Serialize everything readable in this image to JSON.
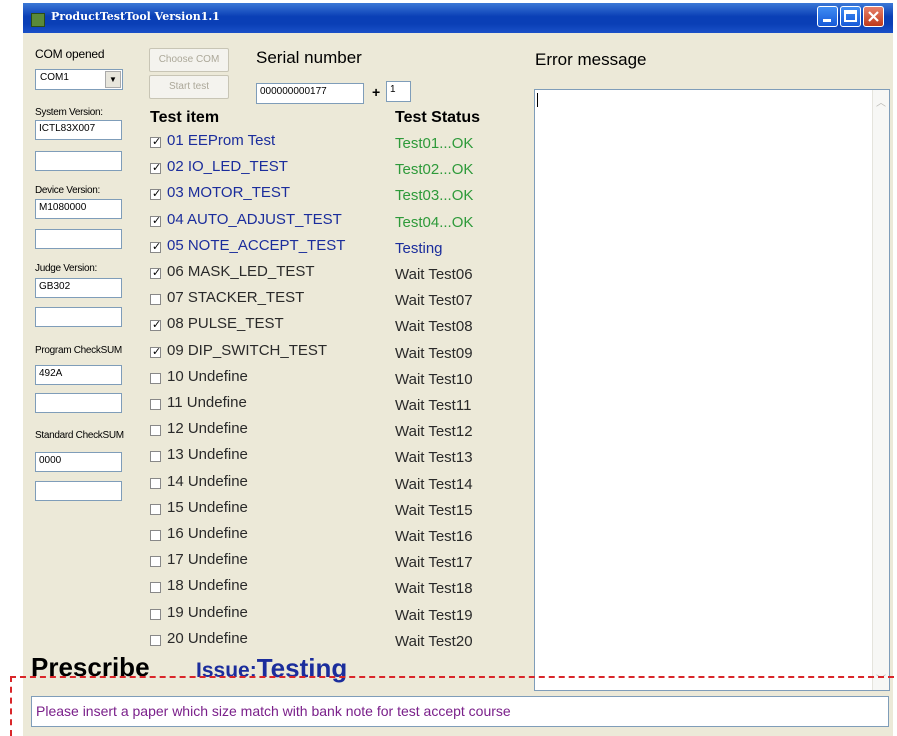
{
  "window": {
    "title": "ProductTestTool  Version1.1"
  },
  "left": {
    "com_label": "COM opened",
    "com_select": "COM1",
    "system_version_label": "System Version:",
    "system_version_value": "ICTL83X007",
    "system_version_value2": "",
    "device_version_label": "Device Version:",
    "device_version_value": "M1080000",
    "device_version_value2": "",
    "judge_version_label": "Judge Version:",
    "judge_version_value": "GB302",
    "judge_version_value2": "",
    "program_checksum_label": "Program CheckSUM",
    "program_checksum_value": "492A",
    "program_checksum_value2": "",
    "standard_checksum_label": "Standard CheckSUM",
    "standard_checksum_value": "0000",
    "standard_checksum_value2": ""
  },
  "buttons": {
    "choose_com": "Choose COM",
    "start_test": "Start test"
  },
  "serial": {
    "label": "Serial number",
    "value": "000000000177",
    "plus": "+",
    "increment": "1"
  },
  "headers": {
    "test_item": "Test item",
    "test_status": "Test Status",
    "error_message": "Error message"
  },
  "tests": [
    {
      "label": "01 EEProm Test",
      "checked": true,
      "status": "Test01...OK",
      "status_color": "#2e9a3a",
      "label_color": "#1b2d9c"
    },
    {
      "label": "02 IO_LED_TEST",
      "checked": true,
      "status": "Test02...OK",
      "status_color": "#2e9a3a",
      "label_color": "#1b2d9c"
    },
    {
      "label": "03 MOTOR_TEST",
      "checked": true,
      "status": "Test03...OK",
      "status_color": "#2e9a3a",
      "label_color": "#1b2d9c"
    },
    {
      "label": "04 AUTO_ADJUST_TEST",
      "checked": true,
      "status": "Test04...OK",
      "status_color": "#2e9a3a",
      "label_color": "#1b2d9c"
    },
    {
      "label": "05 NOTE_ACCEPT_TEST",
      "checked": true,
      "status": "Testing",
      "status_color": "#1b2d9c",
      "label_color": "#1b2d9c"
    },
    {
      "label": "06 MASK_LED_TEST",
      "checked": true,
      "status": "Wait Test06",
      "status_color": "#2a2a2a",
      "label_color": "#2a2a2a"
    },
    {
      "label": "07 STACKER_TEST",
      "checked": false,
      "status": "Wait Test07",
      "status_color": "#2a2a2a",
      "label_color": "#2a2a2a"
    },
    {
      "label": "08 PULSE_TEST",
      "checked": true,
      "status": "Wait Test08",
      "status_color": "#2a2a2a",
      "label_color": "#2a2a2a"
    },
    {
      "label": "09 DIP_SWITCH_TEST",
      "checked": true,
      "status": "Wait Test09",
      "status_color": "#2a2a2a",
      "label_color": "#2a2a2a"
    },
    {
      "label": "10 Undefine",
      "checked": false,
      "status": "Wait Test10",
      "status_color": "#2a2a2a",
      "label_color": "#2a2a2a"
    },
    {
      "label": "11 Undefine",
      "checked": false,
      "status": "Wait Test11",
      "status_color": "#2a2a2a",
      "label_color": "#2a2a2a"
    },
    {
      "label": "12 Undefine",
      "checked": false,
      "status": "Wait Test12",
      "status_color": "#2a2a2a",
      "label_color": "#2a2a2a"
    },
    {
      "label": "13 Undefine",
      "checked": false,
      "status": "Wait Test13",
      "status_color": "#2a2a2a",
      "label_color": "#2a2a2a"
    },
    {
      "label": "14 Undefine",
      "checked": false,
      "status": "Wait Test14",
      "status_color": "#2a2a2a",
      "label_color": "#2a2a2a"
    },
    {
      "label": "15 Undefine",
      "checked": false,
      "status": "Wait Test15",
      "status_color": "#2a2a2a",
      "label_color": "#2a2a2a"
    },
    {
      "label": "16 Undefine",
      "checked": false,
      "status": "Wait Test16",
      "status_color": "#2a2a2a",
      "label_color": "#2a2a2a"
    },
    {
      "label": "17 Undefine",
      "checked": false,
      "status": "Wait Test17",
      "status_color": "#2a2a2a",
      "label_color": "#2a2a2a"
    },
    {
      "label": "18 Undefine",
      "checked": false,
      "status": "Wait Test18",
      "status_color": "#2a2a2a",
      "label_color": "#2a2a2a"
    },
    {
      "label": "19 Undefine",
      "checked": false,
      "status": "Wait Test19",
      "status_color": "#2a2a2a",
      "label_color": "#2a2a2a"
    },
    {
      "label": "20 Undefine",
      "checked": false,
      "status": "Wait Test20",
      "status_color": "#2a2a2a",
      "label_color": "#2a2a2a"
    }
  ],
  "footer": {
    "prescribe": "Prescribe",
    "issue_prefix": "Issue:",
    "issue_value": "Testing",
    "message": "Please insert a paper which size match with bank note for test accept course"
  }
}
